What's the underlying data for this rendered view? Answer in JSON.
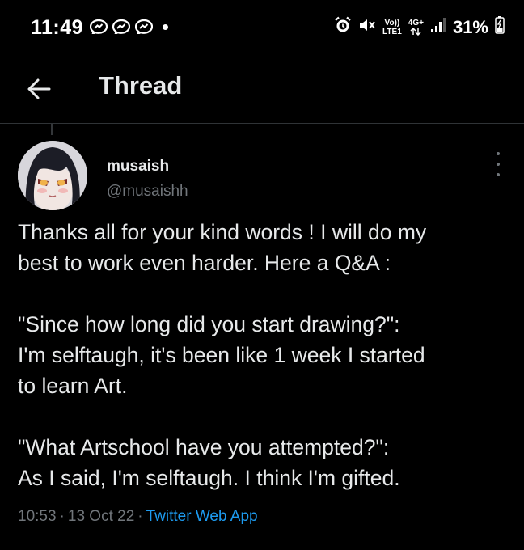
{
  "status_bar": {
    "time": "11:49",
    "network_top": "Vo))",
    "network_bottom": "LTE1",
    "network_gen": "4G+",
    "battery": "31%",
    "icons": [
      "messenger-icon",
      "messenger-icon",
      "messenger-icon",
      "alarm-icon",
      "mute-icon",
      "signal-icon",
      "battery-icon"
    ]
  },
  "header": {
    "title": "Thread",
    "back_icon": "arrow-left-icon"
  },
  "tweet": {
    "name": "musaish",
    "handle": "@musaishh",
    "lines": [
      "Thanks all for your kind words ! I will do my",
      "best to work even harder. Here a Q&A :",
      "",
      "\"Since how long did you start drawing?\":",
      "I'm selftaugh, it's been like 1 week I started",
      "to learn Art.",
      "",
      "\"What Artschool have you attempted?\":",
      "As I said, I'm selftaugh. I think I'm gifted."
    ],
    "time": "10:53",
    "date": "13 Oct 22",
    "separator": "·",
    "source": "Twitter Web App"
  },
  "colors": {
    "background": "#000000",
    "text": "#e7e9ea",
    "muted": "#71767b",
    "accent": "#1d9bf0",
    "divider": "#2f3336"
  }
}
